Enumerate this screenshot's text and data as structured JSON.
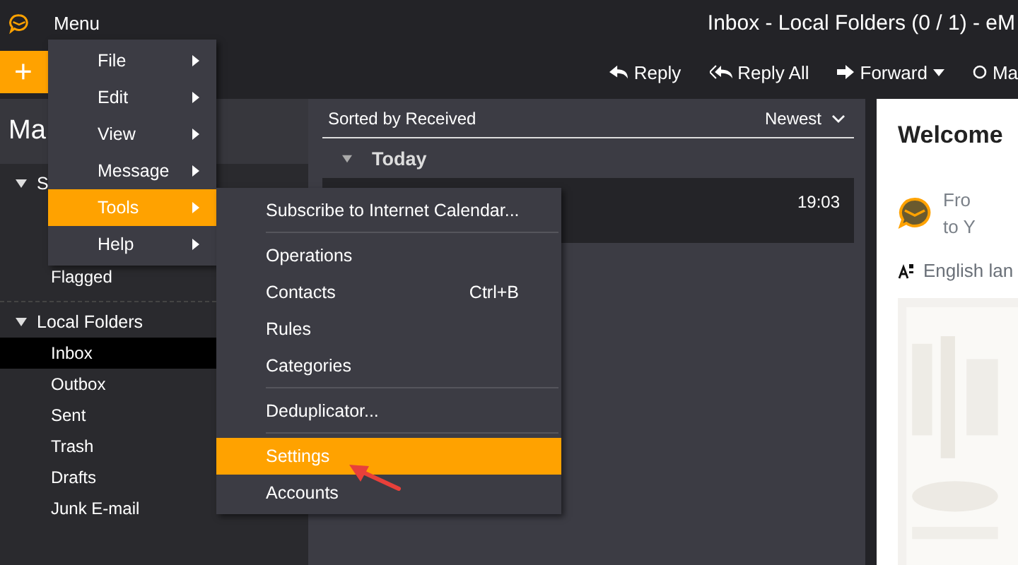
{
  "title_bar": {
    "menu_label": "Menu",
    "title": "Inbox - Local Folders (0 / 1) - eM"
  },
  "toolbar": {
    "new_button": "+",
    "actions": [
      {
        "label": "Reply",
        "kind": "reply",
        "dropdown": false
      },
      {
        "label": "Reply All",
        "kind": "reply-all",
        "dropdown": false
      },
      {
        "label": "Forward",
        "kind": "forward",
        "dropdown": true
      },
      {
        "label": "Ma",
        "kind": "mark",
        "dropdown": false
      }
    ]
  },
  "sidebar": {
    "header": "Ma",
    "groups": [
      {
        "label": "S",
        "expanded": true,
        "children": [
          {
            "label": "Flagged",
            "selected": false
          }
        ]
      },
      {
        "label": "Local Folders",
        "expanded": true,
        "children": [
          {
            "label": "Inbox",
            "selected": true
          },
          {
            "label": "Outbox",
            "selected": false
          },
          {
            "label": "Sent",
            "selected": false
          },
          {
            "label": "Trash",
            "selected": false
          },
          {
            "label": "Drafts",
            "selected": false
          },
          {
            "label": "Junk E-mail",
            "selected": false
          }
        ]
      }
    ]
  },
  "message_list": {
    "sort_label": "Sorted by Received",
    "order": "Newest",
    "groups": [
      {
        "label": "Today",
        "expanded": true,
        "messages": [
          {
            "time": "19:03",
            "selected": true
          }
        ]
      }
    ]
  },
  "preview": {
    "heading": "Welcome",
    "line_1": "Fro",
    "line_2": "to Y",
    "language": "English lan"
  },
  "menu": {
    "items": [
      {
        "label": "File",
        "selected": false,
        "has_submenu": true
      },
      {
        "label": "Edit",
        "selected": false,
        "has_submenu": true
      },
      {
        "label": "View",
        "selected": false,
        "has_submenu": true
      },
      {
        "label": "Message",
        "selected": false,
        "has_submenu": true
      },
      {
        "label": "Tools",
        "selected": true,
        "has_submenu": true
      },
      {
        "label": "Help",
        "selected": false,
        "has_submenu": true
      }
    ]
  },
  "submenu": {
    "sections": [
      [
        {
          "label": "Subscribe to Internet Calendar...",
          "selected": false
        }
      ],
      [
        {
          "label": "Operations",
          "selected": false
        },
        {
          "label": "Contacts",
          "shortcut": "Ctrl+B",
          "selected": false
        },
        {
          "label": "Rules",
          "selected": false
        },
        {
          "label": "Categories",
          "selected": false
        }
      ],
      [
        {
          "label": "Deduplicator...",
          "selected": false
        }
      ],
      [
        {
          "label": "Settings",
          "selected": true
        },
        {
          "label": "Accounts",
          "selected": false
        }
      ]
    ]
  }
}
